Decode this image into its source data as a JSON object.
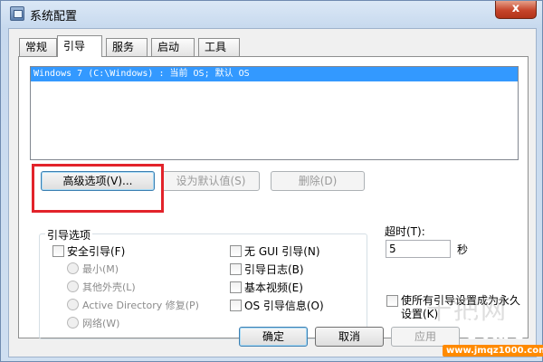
{
  "window": {
    "title": "系统配置",
    "close_label": "x"
  },
  "tabs": [
    {
      "label": "常规"
    },
    {
      "label": "引导",
      "active": true
    },
    {
      "label": "服务"
    },
    {
      "label": "启动"
    },
    {
      "label": "工具"
    }
  ],
  "boot_list": {
    "entries": [
      "Windows 7 (C:\\Windows) : 当前 OS; 默认 OS"
    ]
  },
  "boot_buttons": {
    "advanced": "高级选项(V)...",
    "set_default": "设为默认值(S)",
    "delete": "删除(D)"
  },
  "boot_options": {
    "group_label": "引导选项",
    "safe_boot": "安全引导(F)",
    "minimal": "最小(M)",
    "alternate_shell": "其他外壳(L)",
    "active_directory": "Active Directory 修复(P)",
    "network": "网络(W)",
    "no_gui": "无 GUI 引导(N)",
    "boot_log": "引导日志(B)",
    "base_video": "基本视频(E)",
    "os_boot_info": "OS 引导信息(O)"
  },
  "timeout": {
    "label": "超时(T):",
    "value": "5",
    "unit": "秒"
  },
  "permanent": {
    "label": "使所有引导设置成为永久设置(K)"
  },
  "footer_buttons": {
    "ok": "确定",
    "cancel": "取消",
    "apply": "应用"
  },
  "watermark": {
    "ghost": "十把网",
    "title": "学知网",
    "url": "www.jmqz1000.com"
  },
  "colors": {
    "selection": "#3399ff",
    "highlight_box": "#e2232a",
    "watermark_orange": "#ff7a00"
  }
}
